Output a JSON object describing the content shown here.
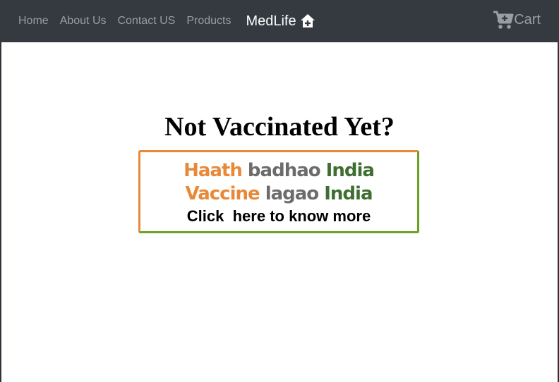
{
  "nav": {
    "links": [
      "Home",
      "About Us",
      "Contact US",
      "Products"
    ],
    "brand": "MedLife",
    "brand_icon": "house-medical-icon",
    "cart_label": "Cart",
    "cart_icon": "cart-plus-icon"
  },
  "main": {
    "headline": "Not Vaccinated Yet?",
    "banner": {
      "line1": [
        "Haath",
        "badhao",
        "India"
      ],
      "line2": [
        "Vaccine",
        "lagao",
        "India"
      ],
      "cta": "Click  here to know more"
    }
  },
  "colors": {
    "navbar": "#343a40",
    "saffron": "#e8893a",
    "grey": "#6c6c6c",
    "green": "#3f6e31",
    "border_green": "#6aa324"
  }
}
